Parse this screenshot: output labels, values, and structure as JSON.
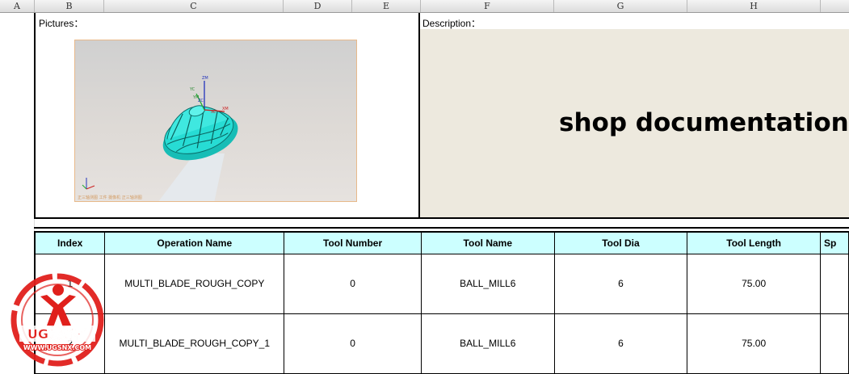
{
  "columns": [
    "A",
    "B",
    "C",
    "D",
    "E",
    "F",
    "G",
    "H"
  ],
  "pictures_label": "Pictures：",
  "description_label": "Description：",
  "description_text": "shop documentation fo",
  "image": {
    "footer_text": "正三轴测图 工件 摄像机 正三轴测图",
    "axis_labels": [
      "ZM",
      "YC",
      "XC",
      "XM",
      "ZC",
      "YM"
    ]
  },
  "table": {
    "headers": [
      "Index",
      "Operation Name",
      "Tool Number",
      "Tool Name",
      "Tool Dia",
      "Tool Length",
      "Sp"
    ],
    "rows": [
      {
        "index": "1",
        "operation_name": "MULTI_BLADE_ROUGH_COPY",
        "tool_number": "0",
        "tool_name": "BALL_MILL6",
        "tool_dia": "6",
        "tool_length": "75.00",
        "sp": ""
      },
      {
        "index": "2",
        "operation_name": "MULTI_BLADE_ROUGH_COPY_1",
        "tool_number": "0",
        "tool_name": "BALL_MILL6",
        "tool_dia": "6",
        "tool_length": "75.00",
        "sp": ""
      }
    ]
  },
  "watermark": {
    "brand": "UG爱好者",
    "url": "WWW.UGSNX.COM"
  },
  "colors": {
    "header_fill": "#ccffff",
    "description_panel": "#ede9de",
    "model": "#1fd6cf",
    "watermark_red": "#e0201c"
  }
}
